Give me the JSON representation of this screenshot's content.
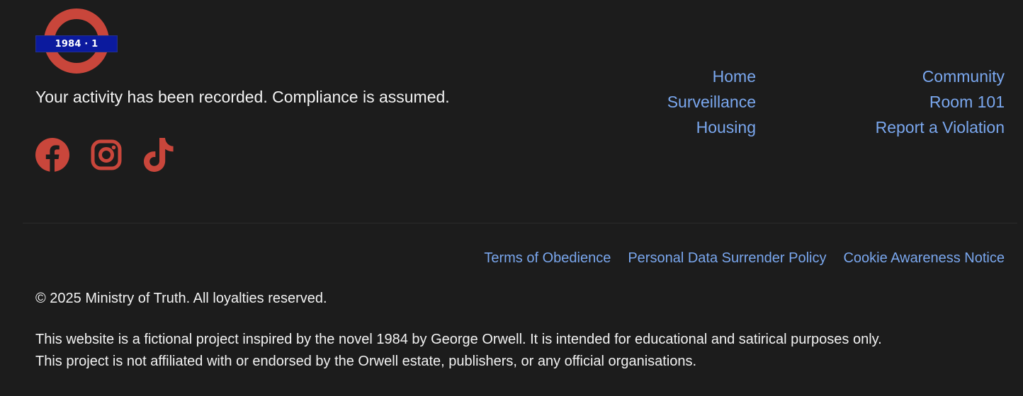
{
  "logo": {
    "text": "1984 · 1"
  },
  "tagline": "Your activity has been recorded. Compliance is assumed.",
  "social": [
    {
      "name": "facebook-icon"
    },
    {
      "name": "instagram-icon"
    },
    {
      "name": "tiktok-icon"
    }
  ],
  "nav": {
    "col1": [
      "Home",
      "Surveillance",
      "Housing"
    ],
    "col2": [
      "Community",
      "Room 101",
      "Report a Violation"
    ]
  },
  "legal_links": [
    "Terms of Obedience",
    "Personal Data Surrender Policy",
    "Cookie Awareness Notice"
  ],
  "copyright": "© 2025 Ministry of Truth. All loyalties reserved.",
  "disclaimer": [
    "This website is a fictional project inspired by the novel 1984 by George Orwell. It is intended for educational and satirical purposes only.",
    "This project is not affiliated with or endorsed by the Orwell estate, publishers, or any official organisations."
  ],
  "colors": {
    "background": "#1c1c1c",
    "accent_red": "#c9463b",
    "link_blue": "#7aa7ee",
    "logo_blue": "#0b1a9e"
  }
}
